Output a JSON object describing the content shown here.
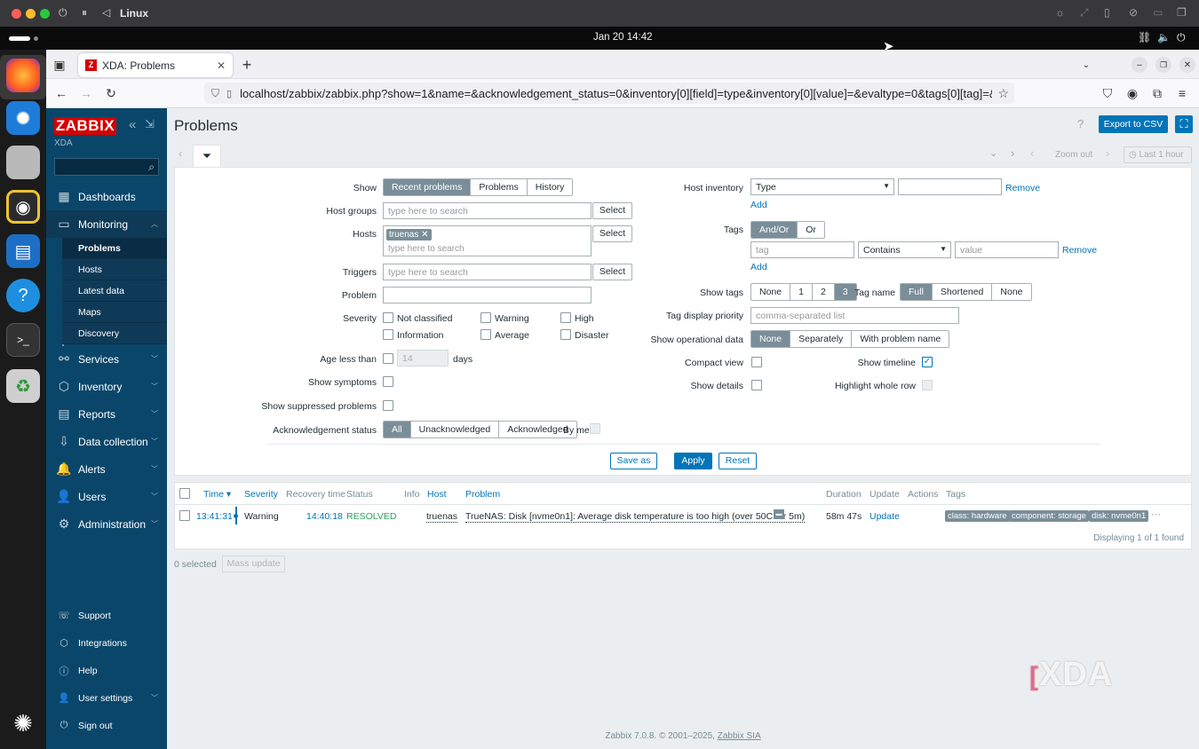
{
  "host": {
    "title": "Linux"
  },
  "gnome": {
    "clock": "Jan 20  14:42"
  },
  "browser": {
    "tab_title": "XDA: Problems",
    "tab_favicon": "Z",
    "url": "localhost/zabbix/zabbix.php?show=1&name=&acknowledgement_status=0&inventory[0][field]=type&inventory[0][value]=&evaltype=0&tags[0][tag]=&tags["
  },
  "sidebar": {
    "logo": "ZABBIX",
    "server": "XDA",
    "menu": [
      {
        "label": "Dashboards",
        "icon": "dashboard-icon"
      },
      {
        "label": "Monitoring",
        "icon": "monitoring-icon"
      },
      {
        "label": "Services",
        "icon": "services-icon"
      },
      {
        "label": "Inventory",
        "icon": "inventory-icon"
      },
      {
        "label": "Reports",
        "icon": "reports-icon"
      },
      {
        "label": "Data collection",
        "icon": "data-collection-icon"
      },
      {
        "label": "Alerts",
        "icon": "alerts-icon"
      },
      {
        "label": "Users",
        "icon": "users-icon"
      },
      {
        "label": "Administration",
        "icon": "administration-icon"
      }
    ],
    "submenu": [
      "Problems",
      "Hosts",
      "Latest data",
      "Maps",
      "Discovery"
    ],
    "bottom": [
      "Support",
      "Integrations",
      "Help",
      "User settings",
      "Sign out"
    ]
  },
  "page": {
    "title": "Problems",
    "help": "?",
    "export": "Export to CSV"
  },
  "timebar": {
    "zoom_out": "Zoom out",
    "range": "Last 1 hour"
  },
  "filter": {
    "show_label": "Show",
    "show_options": [
      "Recent problems",
      "Problems",
      "History"
    ],
    "host_groups_label": "Host groups",
    "hosts_label": "Hosts",
    "host_chip": "truenas",
    "triggers_label": "Triggers",
    "problem_label": "Problem",
    "placeholder": "type here to search",
    "select": "Select",
    "severity_label": "Severity",
    "severities": [
      "Not classified",
      "Warning",
      "High",
      "Information",
      "Average",
      "Disaster"
    ],
    "age_label": "Age less than",
    "age_value": "14",
    "age_unit": "days",
    "symptoms_label": "Show symptoms",
    "suppressed_label": "Show suppressed problems",
    "ack_label": "Acknowledgement status",
    "ack_options": [
      "All",
      "Unacknowledged",
      "Acknowledged"
    ],
    "by_me": "By me",
    "inventory_label": "Host inventory",
    "inventory_field": "Type",
    "remove": "Remove",
    "add": "Add",
    "tags_label": "Tags",
    "tags_eval": [
      "And/Or",
      "Or"
    ],
    "tag_placeholder": "tag",
    "tag_operator": "Contains",
    "value_placeholder": "value",
    "show_tags_label": "Show tags",
    "show_tags_options": [
      "None",
      "1",
      "2",
      "3"
    ],
    "tag_name_label": "Tag name",
    "tag_name_options": [
      "Full",
      "Shortened",
      "None"
    ],
    "tag_priority_label": "Tag display priority",
    "tag_priority_placeholder": "comma-separated list",
    "opdata_label": "Show operational data",
    "opdata_options": [
      "None",
      "Separately",
      "With problem name"
    ],
    "compact_label": "Compact view",
    "timeline_label": "Show timeline",
    "details_label": "Show details",
    "highlight_label": "Highlight whole row",
    "save_as": "Save as",
    "apply": "Apply",
    "reset": "Reset"
  },
  "table": {
    "headers": [
      "Time ▾",
      "Severity",
      "Recovery time",
      "Status",
      "Info",
      "Host",
      "Problem",
      "Duration",
      "Update",
      "Actions",
      "Tags"
    ],
    "rows": [
      {
        "time": "13:41:31",
        "severity": "Warning",
        "recovery": "14:40:18",
        "status": "RESOLVED",
        "host": "truenas",
        "problem": "TrueNAS: Disk [nvme0n1]: Average disk temperature is too high (over 50C for 5m)",
        "duration": "58m 47s",
        "update": "Update",
        "tags": [
          "class: hardware",
          "component: storage",
          "disk: nvme0n1"
        ]
      }
    ],
    "footer": "Displaying 1 of 1 found"
  },
  "mass": {
    "selected": "0 selected",
    "button": "Mass update"
  },
  "footer": {
    "text": "Zabbix 7.0.8. © 2001–2025, ",
    "link": "Zabbix SIA"
  },
  "watermark": "XDA",
  "colors": {
    "sidebar": "#0a466a",
    "accent": "#0275b8",
    "resolved": "#59db8f",
    "logo": "#d40000"
  }
}
